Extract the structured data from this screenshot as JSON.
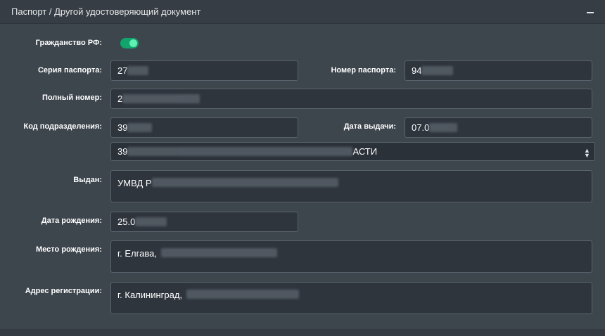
{
  "panel": {
    "title": "Паспорт / Другой удостоверяющий документ"
  },
  "citizenship": {
    "label": "Гражданство РФ:",
    "enabled": true
  },
  "passport_series": {
    "label": "Серия паспорта:",
    "value": "27"
  },
  "passport_number": {
    "label": "Номер паспорта:",
    "value": "94"
  },
  "full_number": {
    "label": "Полный номер:",
    "value": "2"
  },
  "division_code": {
    "label": "Код подразделения:",
    "value": "39"
  },
  "issue_date": {
    "label": "Дата выдачи:",
    "value": "07.0"
  },
  "division_select": {
    "value_start": "39",
    "value_end": "АСТИ"
  },
  "issued_by": {
    "label": "Выдан:",
    "value": "УМВД Р"
  },
  "birth_date": {
    "label": "Дата рождения:",
    "value": "25.0"
  },
  "birth_place": {
    "label": "Место рождения:",
    "value": "г. Елгава,"
  },
  "registration_address": {
    "label": "Адрес регистрации:",
    "value": "г. Калининград,"
  },
  "colors": {
    "toggle_on": "#13a36d",
    "panel_bg": "#3d454d",
    "field_bg": "#2f353d"
  }
}
